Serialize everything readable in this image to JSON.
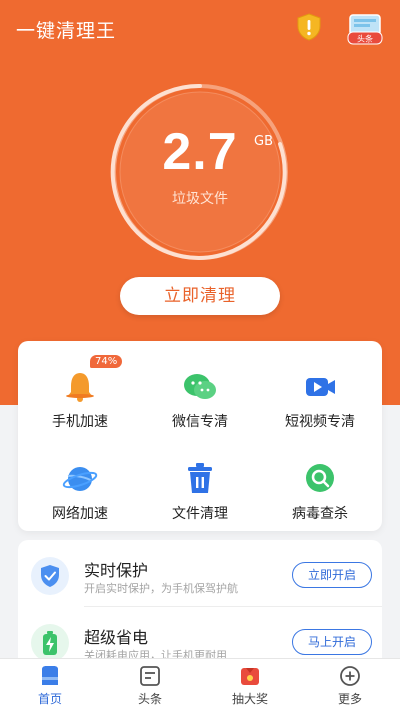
{
  "app": {
    "title": "一键清理王"
  },
  "header": {
    "news_badge": "头条"
  },
  "gauge": {
    "value": "2.7",
    "unit": "GB",
    "label": "垃圾文件"
  },
  "clean_button": {
    "label": "立即清理"
  },
  "tools": [
    {
      "label": "手机加速",
      "icon": "bell-icon",
      "badge": "74%"
    },
    {
      "label": "微信专清",
      "icon": "wechat-icon"
    },
    {
      "label": "短视频专清",
      "icon": "video-camera-icon"
    },
    {
      "label": "网络加速",
      "icon": "planet-icon"
    },
    {
      "label": "文件清理",
      "icon": "trash-icon"
    },
    {
      "label": "病毒查杀",
      "icon": "magnifier-icon"
    }
  ],
  "features": [
    {
      "title": "实时保护",
      "subtitle": "开启实时保护，为手机保驾护航",
      "button": "立即开启",
      "icon": "shield-check-icon"
    },
    {
      "title": "超级省电",
      "subtitle": "关闭耗电应用，让手机更耐用",
      "button": "马上开启",
      "icon": "battery-icon"
    }
  ],
  "tabbar": [
    {
      "label": "首页",
      "icon": "home-icon",
      "active": true
    },
    {
      "label": "头条",
      "icon": "news-icon"
    },
    {
      "label": "抽大奖",
      "icon": "gift-icon"
    },
    {
      "label": "更多",
      "icon": "more-icon"
    }
  ],
  "colors": {
    "brand_orange": "#ef6a30",
    "accent_blue": "#2f6ad8"
  }
}
